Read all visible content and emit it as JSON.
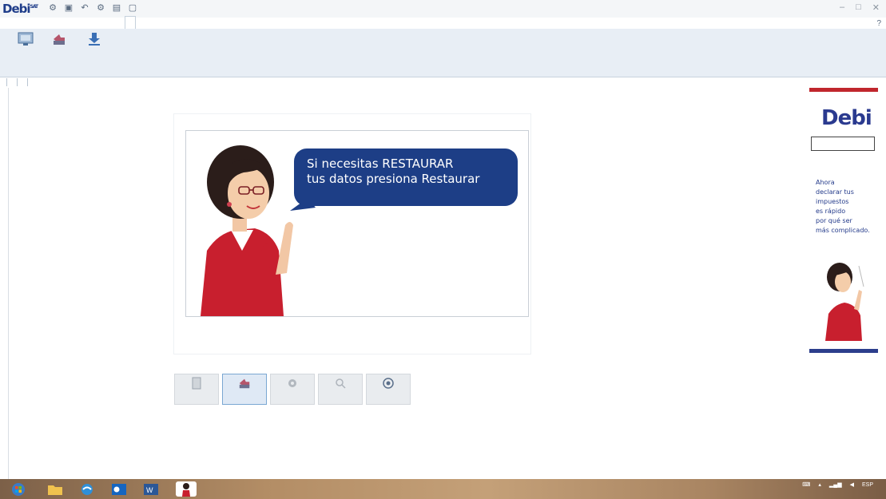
{
  "app": {
    "logo": "Debi",
    "window_title": "",
    "window_buttons": [
      "–",
      "□",
      "✕"
    ]
  },
  "ribbon": {
    "tabs": [
      "",
      "",
      "",
      "",
      "",
      "",
      "",
      "",
      ""
    ],
    "active_tab_index": 7,
    "help_icon": "question-icon",
    "buttons": [
      {
        "name": "respaldar-button",
        "icon": "screen-icon",
        "label": ""
      },
      {
        "name": "restaurar-button",
        "icon": "restore-icon",
        "label": ""
      },
      {
        "name": "descargar-button",
        "icon": "download-icon",
        "label": ""
      }
    ],
    "groups": [
      "",
      "",
      ""
    ]
  },
  "banner": {
    "bubble_line1": "Si necesitas RESTAURAR",
    "bubble_line2": "tus datos presiona Restaurar"
  },
  "actions": [
    {
      "name": "action-button-1",
      "icon": "document-icon",
      "label": "",
      "selected": false
    },
    {
      "name": "action-button-restaurar",
      "icon": "restore-icon",
      "label": "",
      "selected": true
    },
    {
      "name": "action-button-3",
      "icon": "gear-icon",
      "label": "",
      "selected": false
    },
    {
      "name": "action-button-4",
      "icon": "search-icon",
      "label": "",
      "selected": false
    },
    {
      "name": "action-button-5",
      "icon": "help-icon",
      "label": "",
      "selected": false
    }
  ],
  "ad": {
    "logo": "Debi",
    "tagline": "",
    "small_text": "",
    "text_line1": "Ahora",
    "text_line2": "declarar tus",
    "text_line3": "impuestos",
    "text_line4": "es rápido",
    "text_line5": "por qué ser",
    "text_line6": "más complicado."
  },
  "taskbar": {
    "items": [
      "start-icon",
      "folder-icon",
      "browser-icon",
      "outlook-icon",
      "word-icon",
      "debi-app-icon"
    ],
    "tray_lang": "ESP",
    "time": "",
    "date": ""
  },
  "colors": {
    "brand_blue": "#1d3e86",
    "brand_red": "#c0262d",
    "ribbon_bg": "#e8eef5"
  }
}
